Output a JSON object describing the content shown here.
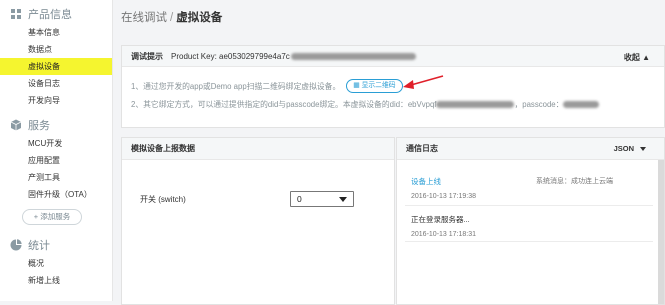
{
  "sidebar": {
    "sections": [
      {
        "title": "产品信息",
        "icon": "product-icon",
        "items": [
          "基本信息",
          "数据点",
          "虚拟设备",
          "设备日志",
          "开发向导"
        ]
      },
      {
        "title": "服务",
        "icon": "cube-icon",
        "items": [
          "MCU开发",
          "应用配置",
          "产测工具",
          "固件升级（OTA）"
        ],
        "add_label": "+ 添加服务"
      },
      {
        "title": "统计",
        "icon": "pie-chart-icon",
        "items": [
          "概况",
          "新增上线"
        ]
      }
    ],
    "active_item": "虚拟设备"
  },
  "header": {
    "breadcrumb": "在线调试",
    "separator": "/",
    "title": "虚拟设备"
  },
  "info_panel": {
    "heading": "调试提示",
    "product_key_prefix": "Product Key: ae053029799e4a7c",
    "collapse_label": "收起 ▲",
    "tip1": "1、通过您开发的app或Demo app扫描二维码绑定虚拟设备。",
    "qr_button": "显示二维码",
    "tip2_prefix": "2、其它绑定方式，可以通过提供指定的did与passcode绑定。本虚拟设备的did：ebVvpqf",
    "tip2_passcode": "，passcode："
  },
  "report_panel": {
    "heading": "模拟设备上报数据",
    "switch_label": "开关 (switch)",
    "switch_value": "0"
  },
  "log_panel": {
    "heading": "通信日志",
    "format": "JSON",
    "entries": [
      {
        "text": "设备上线",
        "note": "系统消息：成功连上云端",
        "time": "2016-10-13 17:19:38"
      },
      {
        "text": "正在登录服务器...",
        "note": "",
        "time": "2016-10-13 17:18:31"
      }
    ]
  },
  "colors": {
    "active_bg": "#f5f52f",
    "accent": "#2a9ed5",
    "arrow": "#e0202a"
  }
}
